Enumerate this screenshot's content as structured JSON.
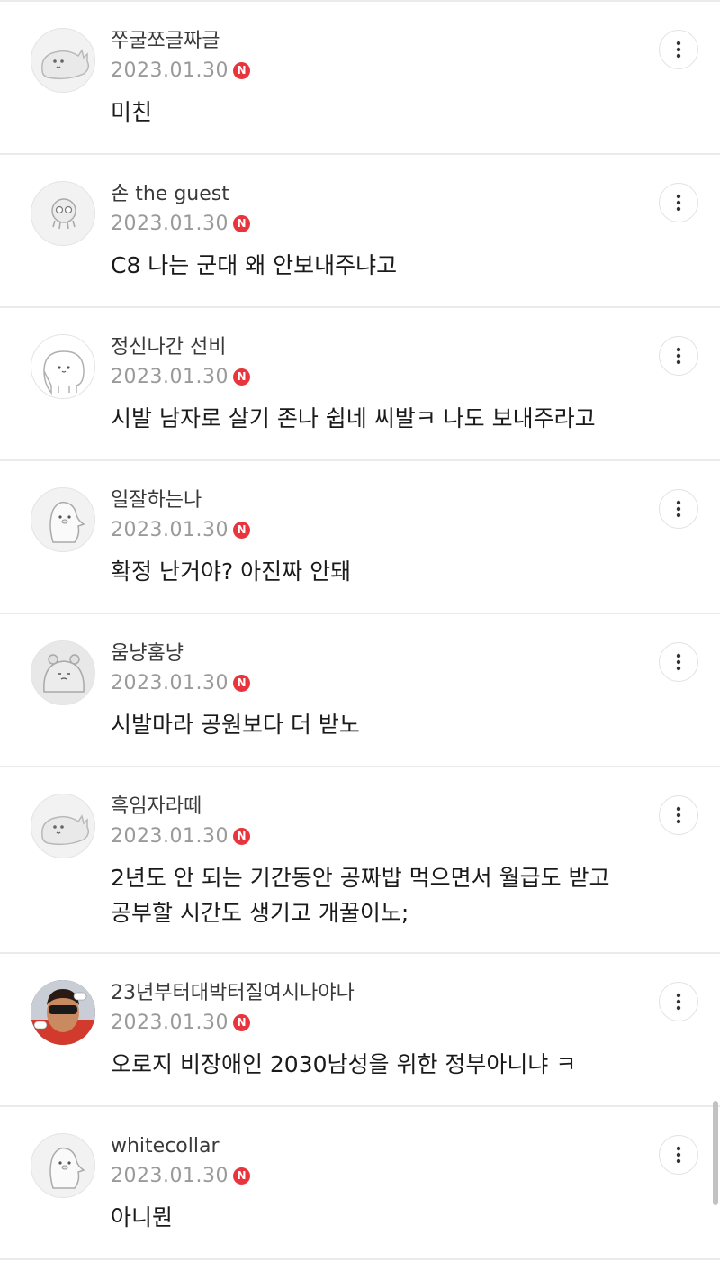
{
  "comments": [
    {
      "nickname": "쭈굴쪼글짜글",
      "date": "2023.01.30",
      "badge": "N",
      "avatar": "dinosaur-avatar",
      "text": "미친"
    },
    {
      "nickname": "손 the guest",
      "date": "2023.01.30",
      "badge": "N",
      "avatar": "octopus-avatar",
      "text": "C8 나는 군대 왜 안보내주냐고"
    },
    {
      "nickname": "정신나간 선비",
      "date": "2023.01.30",
      "badge": "N",
      "avatar": "blob-avatar",
      "text": "시발 남자로 살기 존나 쉽네 씨발ㅋ 나도 보내주라고"
    },
    {
      "nickname": "일잘하는나",
      "date": "2023.01.30",
      "badge": "N",
      "avatar": "penguin-avatar",
      "text": "확정 난거야? 아진짜 안돼"
    },
    {
      "nickname": "움냥훔냥",
      "date": "2023.01.30",
      "badge": "N",
      "avatar": "hamster-avatar",
      "text": "시발마라 공원보다 더 받노"
    },
    {
      "nickname": "흑임자라떼",
      "date": "2023.01.30",
      "badge": "N",
      "avatar": "dinosaur-avatar",
      "text": "2년도 안 되는 기간동안 공짜밥 먹으면서 월급도 받고\n공부할 시간도 생기고 개꿀이노;"
    },
    {
      "nickname": "23년부터대박터질여시나야나",
      "date": "2023.01.30",
      "badge": "N",
      "avatar": "photo-avatar",
      "text": "오로지 비장애인 2030남성을 위한 정부아니냐 ㅋ"
    },
    {
      "nickname": "whitecollar",
      "date": "2023.01.30",
      "badge": "N",
      "avatar": "penguin-avatar",
      "text": "아니뭔"
    }
  ],
  "colors": {
    "badge": "#e8343c",
    "divider": "#ebebeb",
    "date": "#9a9a9a"
  },
  "icons": {
    "more": "more-vertical-icon"
  }
}
